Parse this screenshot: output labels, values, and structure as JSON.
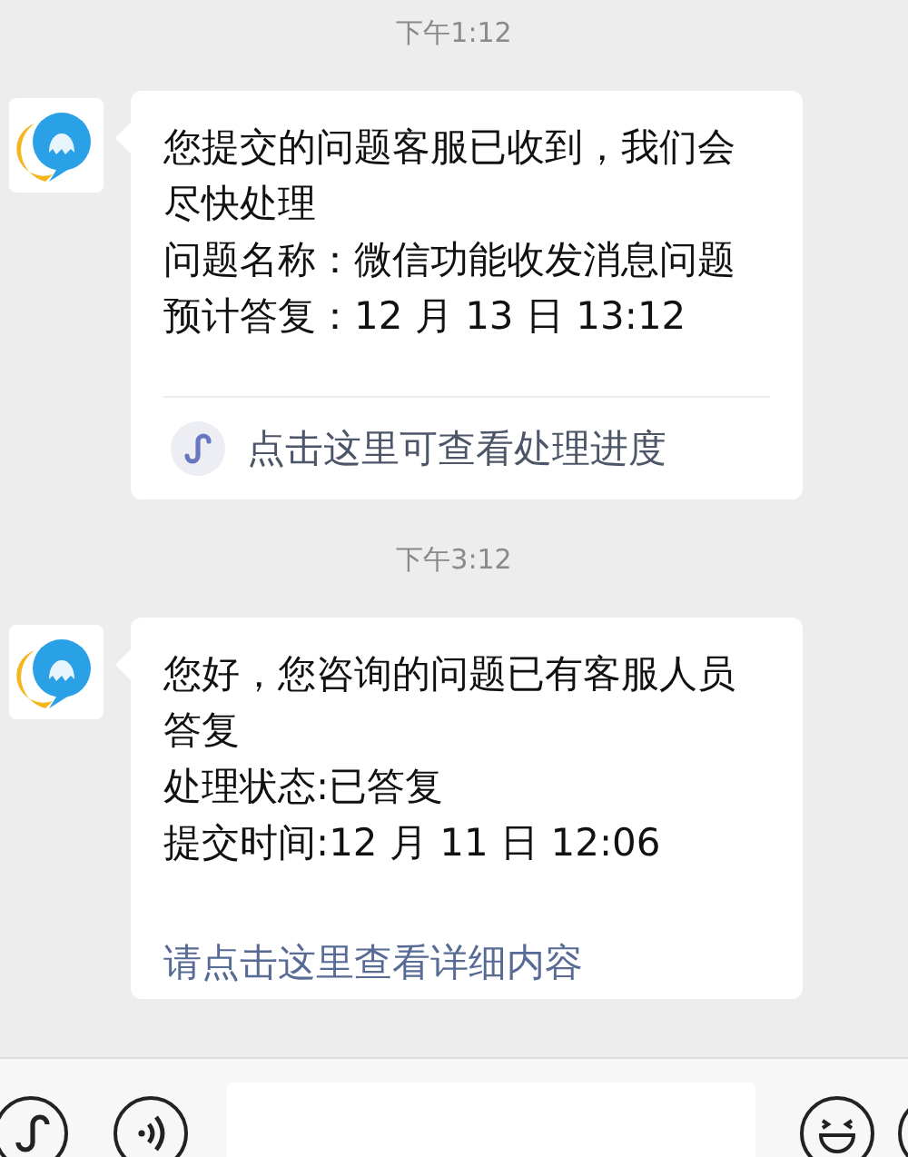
{
  "messages": [
    {
      "time": "下午1:12",
      "lines": [
        "您提交的问题客服已收到，我们会尽快处理",
        "问题名称：微信功能收发消息问题",
        "预计答复：12 月 13 日 13:12"
      ],
      "link": {
        "kind": "mini-program",
        "text": "点击这里可查看处理进度"
      }
    },
    {
      "time": "下午3:12",
      "lines": [
        "您好，您咨询的问题已有客服人员答复",
        "处理状态:已答复",
        "提交时间:12 月 11 日 12:06"
      ],
      "link": {
        "kind": "plain",
        "text": "请点击这里查看详细内容"
      }
    }
  ]
}
